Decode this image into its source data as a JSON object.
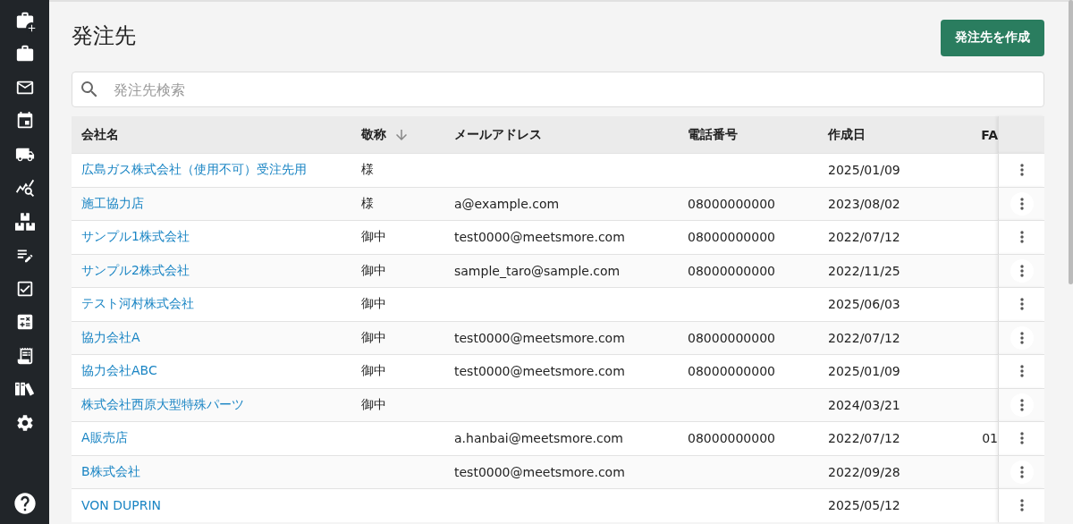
{
  "page": {
    "title": "発注先"
  },
  "create_button": {
    "label": "発注先を作成"
  },
  "search": {
    "placeholder": "発注先検索"
  },
  "table": {
    "columns": [
      {
        "label": "会社名",
        "sorted": false
      },
      {
        "label": "敬称",
        "sorted": true
      },
      {
        "label": "メールアドレス",
        "sorted": false
      },
      {
        "label": "電話番号",
        "sorted": false
      },
      {
        "label": "作成日",
        "sorted": false
      },
      {
        "label": "FA",
        "sorted": false
      }
    ],
    "rows": [
      {
        "company": "広島ガス株式会社（使用不可）受注先用",
        "honorific": "様",
        "created": "2025/01/09"
      },
      {
        "company": "施工協力店",
        "honorific": "様",
        "email": "a@example.com",
        "phone": "08000000000",
        "created": "2023/08/02"
      },
      {
        "company": "サンプル1株式会社",
        "honorific": "御中",
        "email": "test0000@meetsmore.com",
        "phone": "08000000000",
        "created": "2022/07/12"
      },
      {
        "company": "サンプル2株式会社",
        "honorific": "御中",
        "email": "sample_taro@sample.com",
        "phone": "08000000000",
        "created": "2022/11/25"
      },
      {
        "company": "テスト河村株式会社",
        "honorific": "御中",
        "created": "2025/06/03"
      },
      {
        "company": "協力会社A",
        "honorific": "御中",
        "email": "test0000@meetsmore.com",
        "phone": "08000000000",
        "created": "2022/07/12"
      },
      {
        "company": "協力会社ABC",
        "honorific": "御中",
        "email": "test0000@meetsmore.com",
        "phone": "08000000000",
        "created": "2025/01/09"
      },
      {
        "company": "株式会社西原大型特殊パーツ",
        "honorific": "御中",
        "created": "2024/03/21"
      },
      {
        "company": "A販売店",
        "email": "a.hanbai@meetsmore.com",
        "phone": "08000000000",
        "created": "2022/07/12",
        "fax": "01"
      },
      {
        "company": "B株式会社",
        "email": "test0000@meetsmore.com",
        "created": "2022/09/28"
      },
      {
        "company": "VON DUPRIN",
        "created": "2025/05/12"
      }
    ]
  }
}
